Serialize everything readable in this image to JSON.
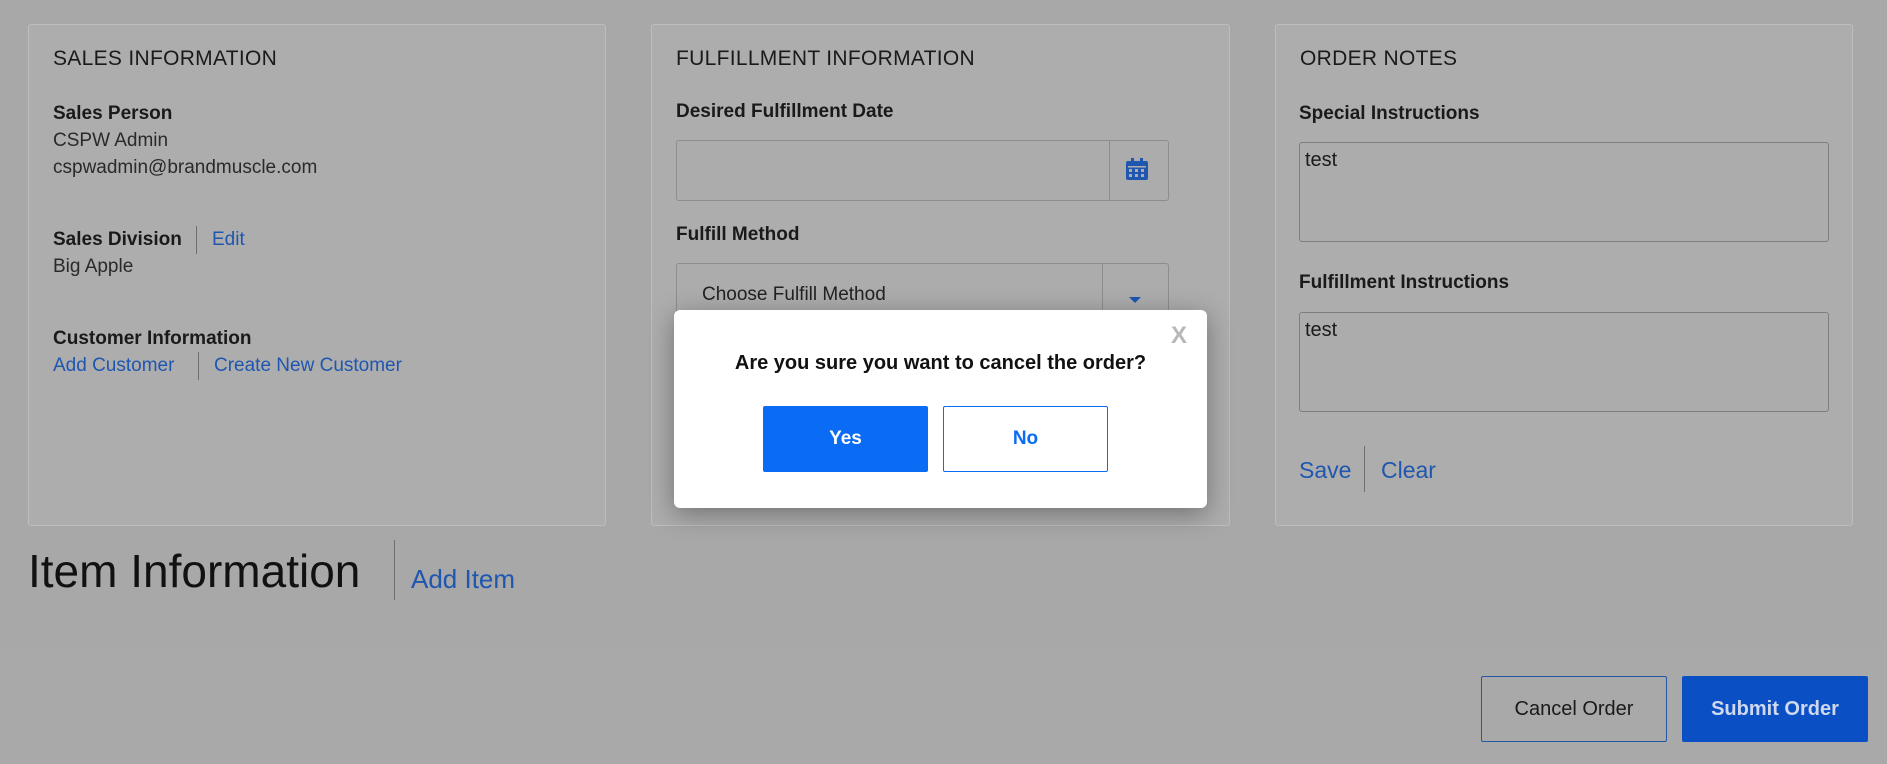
{
  "sales": {
    "title": "SALES INFORMATION",
    "person_label": "Sales Person",
    "person_name": "CSPW Admin",
    "person_email": "cspwadmin@brandmuscle.com",
    "division_label": "Sales Division",
    "division_edit": "Edit",
    "division_value": "Big Apple",
    "customer_label": "Customer Information",
    "add_customer": "Add Customer",
    "create_customer": "Create New Customer"
  },
  "fulfillment": {
    "title": "FULFILLMENT INFORMATION",
    "date_label": "Desired Fulfillment Date",
    "date_value": "",
    "method_label": "Fulfill Method",
    "method_value": "Choose Fulfill Method"
  },
  "notes": {
    "title": "ORDER NOTES",
    "special_label": "Special Instructions",
    "special_value": "test",
    "fulfill_label": "Fulfillment Instructions",
    "fulfill_value": "test",
    "save": "Save",
    "clear": "Clear"
  },
  "items": {
    "title": "Item Information",
    "add_item": "Add Item"
  },
  "footer": {
    "cancel": "Cancel Order",
    "submit": "Submit Order"
  },
  "modal": {
    "close": "X",
    "question": "Are you sure you want to cancel the order?",
    "yes": "Yes",
    "no": "No"
  },
  "colors": {
    "link": "#1f56b0",
    "primary": "#0a6cf5",
    "submit": "#0a4fc4",
    "overlay": "#a8a8a8"
  },
  "icons": {
    "calendar": "calendar-icon",
    "dropdown": "caret-down-icon"
  }
}
